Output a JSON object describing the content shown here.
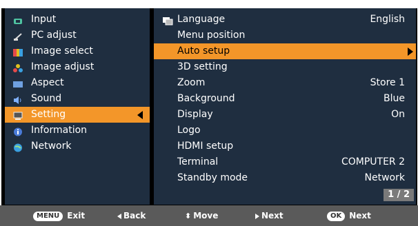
{
  "left_menu": {
    "items": [
      {
        "label": "Input",
        "icon": "input-icon",
        "color": "#4fc3a1"
      },
      {
        "label": "PC adjust",
        "icon": "pc-adjust-icon",
        "color": "#cccccc"
      },
      {
        "label": "Image select",
        "icon": "image-select-icon",
        "color": "#e64a4a"
      },
      {
        "label": "Image adjust",
        "icon": "image-adjust-icon",
        "color": "#e0c020"
      },
      {
        "label": "Aspect",
        "icon": "aspect-icon",
        "color": "#6fa0e0"
      },
      {
        "label": "Sound",
        "icon": "sound-icon",
        "color": "#7fb0ff"
      },
      {
        "label": "Setting",
        "icon": "setting-icon",
        "color": "#cfcfcf",
        "selected": true
      },
      {
        "label": "Information",
        "icon": "information-icon",
        "color": "#4a7bd8"
      },
      {
        "label": "Network",
        "icon": "network-icon",
        "color": "#3aa0e0"
      }
    ]
  },
  "right_menu": {
    "items": [
      {
        "label": "Language",
        "value": "English",
        "icon": "language-icon"
      },
      {
        "label": "Menu position",
        "value": ""
      },
      {
        "label": "Auto setup",
        "value": "",
        "selected": true
      },
      {
        "label": "3D setting",
        "value": ""
      },
      {
        "label": "Zoom",
        "value": "Store 1"
      },
      {
        "label": "Background",
        "value": "Blue"
      },
      {
        "label": "Display",
        "value": "On"
      },
      {
        "label": "Logo",
        "value": ""
      },
      {
        "label": "HDMI setup",
        "value": ""
      },
      {
        "label": "Terminal",
        "value": "COMPUTER 2"
      },
      {
        "label": "Standby mode",
        "value": "Network"
      }
    ],
    "page": "1 / 2"
  },
  "hints": {
    "exit_key": "MENU",
    "exit": "Exit",
    "back": "Back",
    "move": "Move",
    "next1": "Next",
    "ok_key": "OK",
    "next2": "Next"
  },
  "colors": {
    "panel": "#1f2e40",
    "highlight": "#f39629",
    "footer": "#5a5a5a"
  }
}
